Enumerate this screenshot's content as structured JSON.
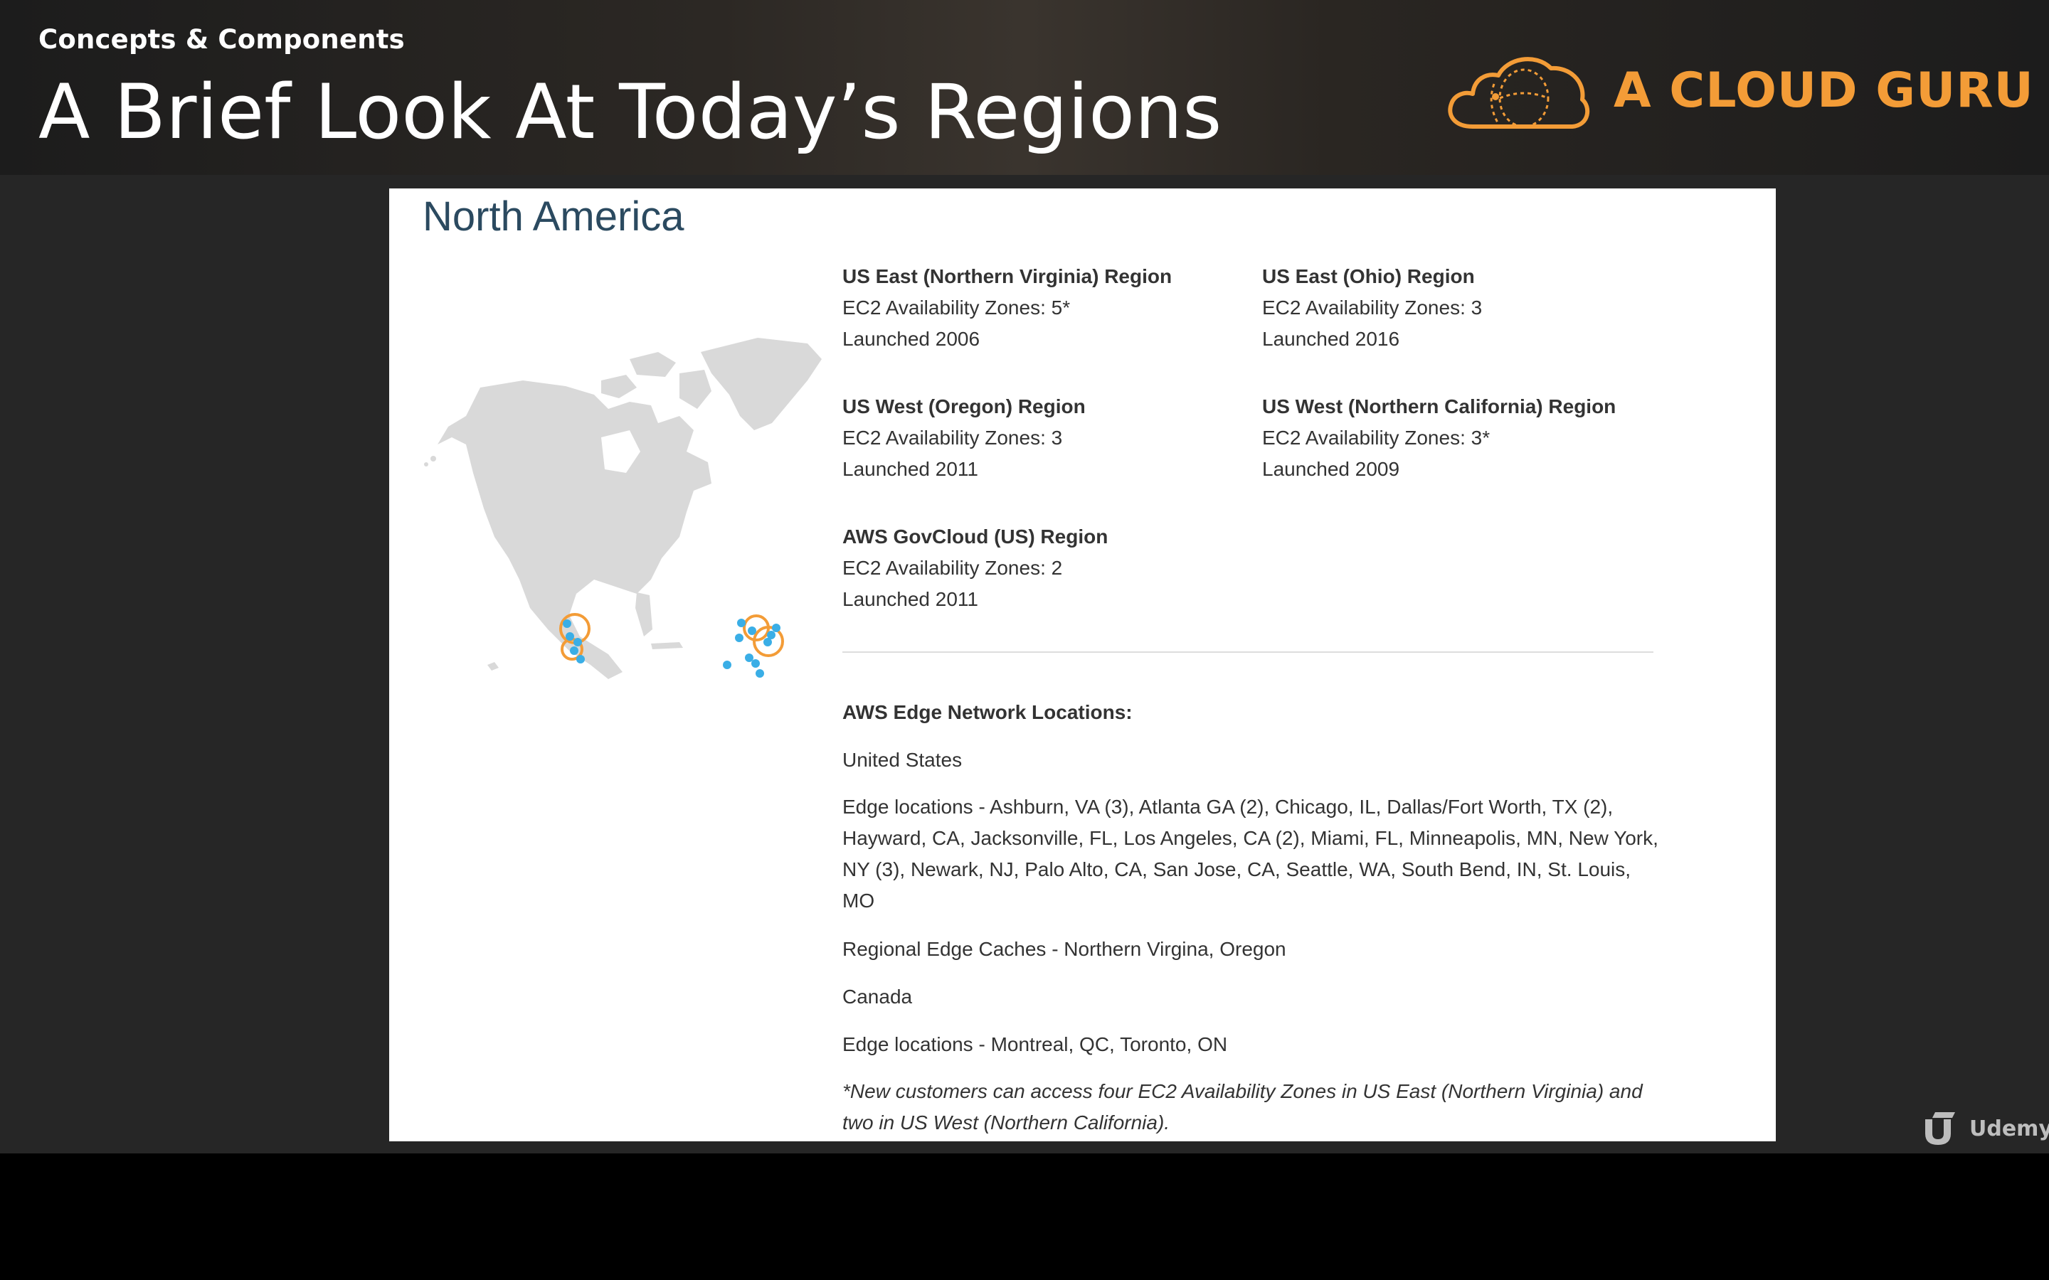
{
  "header": {
    "subtitle": "Concepts & Components",
    "title": "A Brief Look At Today’s Regions",
    "brand": "A CLOUD GURU"
  },
  "slide": {
    "heading": "North America",
    "regions": [
      {
        "name": "US East (Northern Virginia) Region",
        "zones": "EC2 Availability Zones: 5*",
        "launched": "Launched 2006"
      },
      {
        "name": "US East (Ohio) Region",
        "zones": "EC2 Availability Zones: 3",
        "launched": "Launched 2016"
      },
      {
        "name": "US West (Oregon) Region",
        "zones": "EC2 Availability Zones: 3",
        "launched": "Launched 2011"
      },
      {
        "name": "US West (Northern California) Region",
        "zones": "EC2 Availability Zones: 3*",
        "launched": "Launched 2009"
      },
      {
        "name": "AWS GovCloud (US) Region",
        "zones": "EC2 Availability Zones: 2",
        "launched": "Launched 2011"
      }
    ],
    "edge": {
      "heading": "AWS Edge Network Locations:",
      "us_label": "United States",
      "us_locations": "Edge locations - Ashburn, VA (3), Atlanta GA (2), Chicago, IL, Dallas/Fort Worth, TX (2), Hayward, CA, Jacksonville, FL, Los Angeles, CA (2), Miami, FL, Minneapolis, MN, New York, NY (3), Newark, NJ, Palo Alto, CA, San Jose, CA, Seattle, WA, South Bend, IN, St. Louis, MO",
      "us_caches": "Regional Edge Caches - Northern Virgina, Oregon",
      "canada_label": "Canada",
      "canada_locations": "Edge locations - Montreal, QC, Toronto, ON"
    },
    "footnote": "*New customers can access four EC2 Availability Zones in US East (Northern Virginia) and two in US West (Northern California)."
  },
  "watermark": {
    "label": "Udemy"
  },
  "colors": {
    "brand_orange": "#f39c37",
    "map_land": "#d9d9d9",
    "marker_blue": "#3aaee6",
    "heading_blue": "#2b4a60"
  },
  "icons": {
    "logo": "cloud-logo-icon",
    "watermark": "udemy-logo-icon"
  }
}
